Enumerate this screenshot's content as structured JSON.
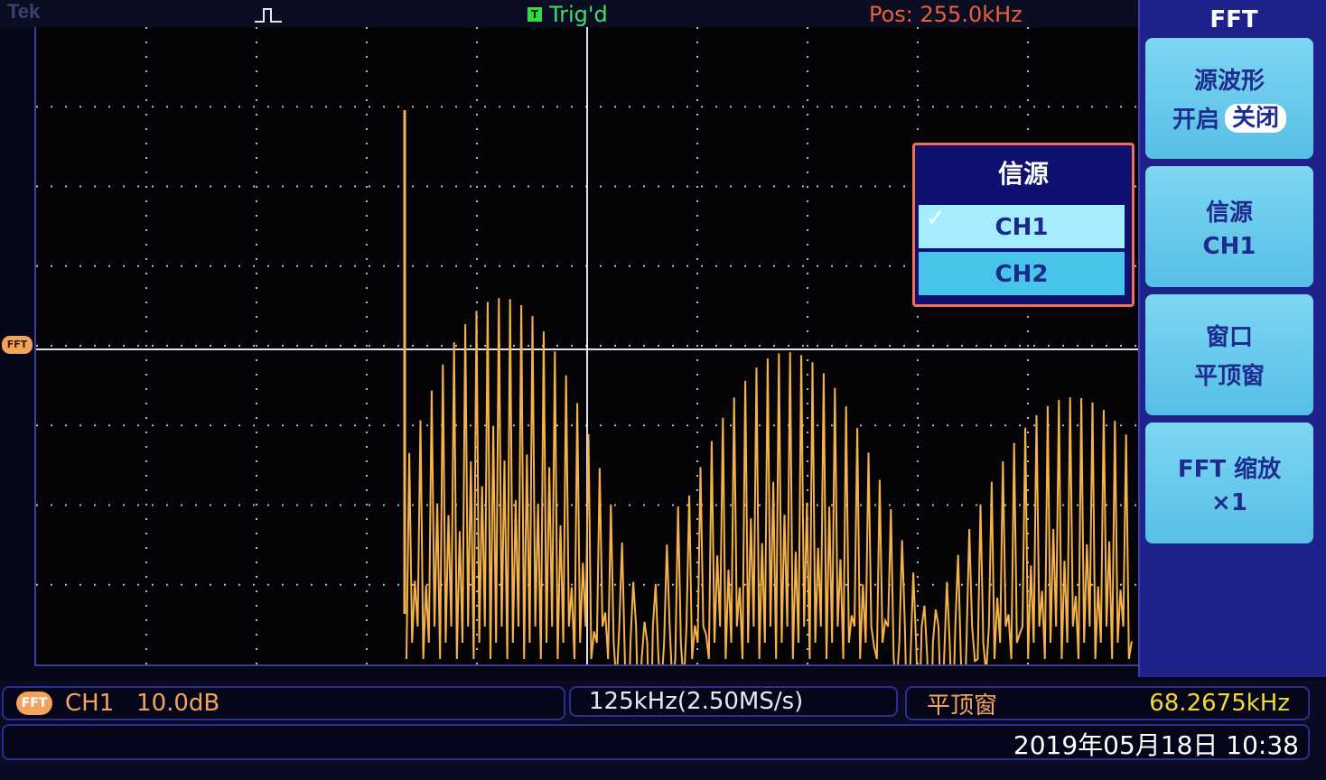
{
  "header": {
    "brand": "Tek",
    "trigger_badge": "T",
    "trigger_status": "Trig'd",
    "position": "Pos: 255.0kHz"
  },
  "reference_marker": "FFT",
  "side_menu": {
    "title": "FFT",
    "buttons": [
      {
        "line1": "源波形",
        "line2_prefix": "开启",
        "line2_pill": "关闭"
      },
      {
        "line1": "信源",
        "line2": "CH1"
      },
      {
        "line1": "窗口",
        "line2": "平顶窗"
      },
      {
        "line1": "FFT 缩放",
        "line2": "×1"
      }
    ]
  },
  "popup": {
    "title": "信源",
    "options": [
      {
        "label": "CH1",
        "selected": true
      },
      {
        "label": "CH2",
        "selected": false
      }
    ]
  },
  "status": {
    "channel_icon": "FFT",
    "channel_text": "CH1   10.0dB",
    "rate": "125kHz(2.50MS/s)",
    "window": "平顶窗",
    "frequency": "68.2675kHz",
    "datetime": "2019年05月18日 10:38"
  },
  "colors": {
    "trace": "#f5b24a",
    "accent_green": "#3be06a",
    "position_orange": "#e8613a",
    "menu_bg": "#20228c",
    "menu_button": "#56bfe6",
    "frequency_yellow": "#f4d834"
  }
}
